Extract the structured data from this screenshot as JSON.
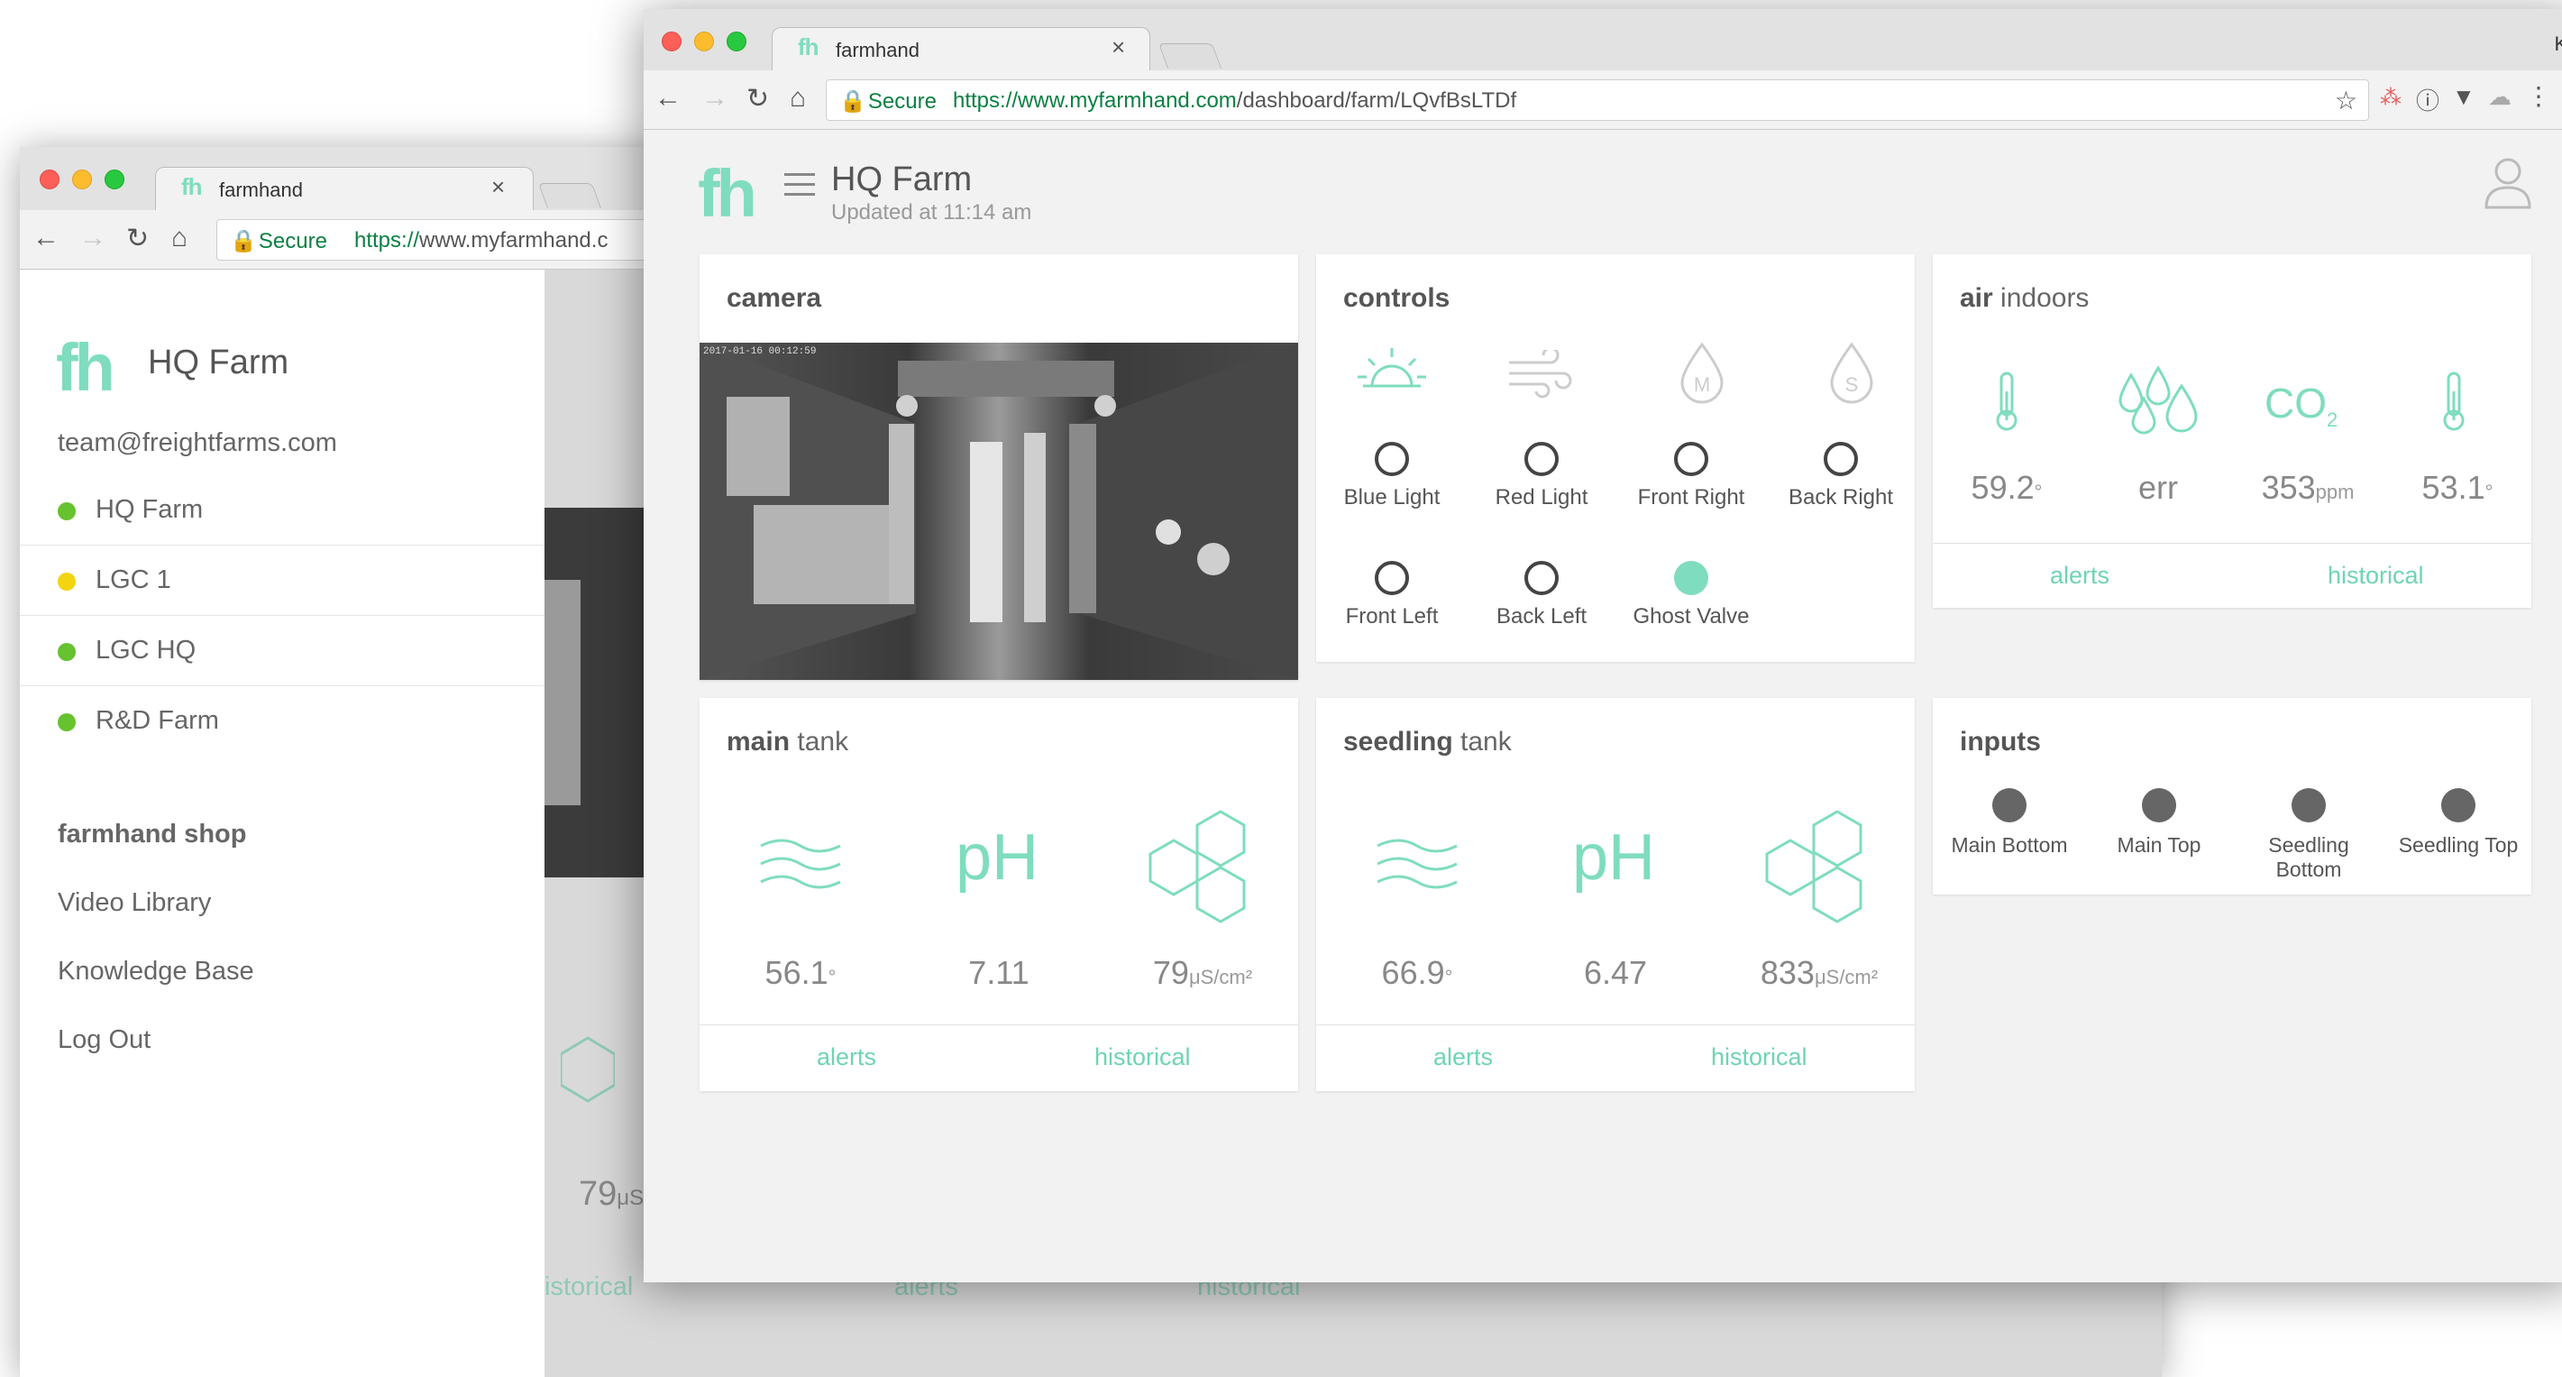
{
  "back_window": {
    "tab_title": "farmhand",
    "tab_favicon": "fh",
    "secure_label": "Secure",
    "url_scheme": "https://",
    "url_host": "www.myfarmhand.c",
    "sidebar": {
      "logo": "fh",
      "farm_name": "HQ Farm",
      "email": "team@freightfarms.com",
      "farms": [
        {
          "label": "HQ Farm",
          "status_color": "#66c22e"
        },
        {
          "label": "LGC 1",
          "status_color": "#f2d410"
        },
        {
          "label": "LGC HQ",
          "status_color": "#66c22e"
        },
        {
          "label": "R&D Farm",
          "status_color": "#66c22e"
        }
      ],
      "shop": "farmhand shop",
      "links": [
        "Video Library",
        "Knowledge Base",
        "Log Out"
      ]
    },
    "behind": {
      "value": "79",
      "unit": "μS",
      "historical": "istorical",
      "alerts": "alerts",
      "historical2": "historical"
    }
  },
  "front_window": {
    "tab_title": "farmhand",
    "tab_favicon": "fh",
    "user_name": "Kyl",
    "secure_label": "Secure",
    "url_scheme": "https://",
    "url_host": "www.myfarmhand.com",
    "url_path": "/dashboard/farm/LQvfBsLTDf"
  },
  "app": {
    "logo": "fh",
    "farm_name": "HQ Farm",
    "updated": "Updated at 11:14 am",
    "accent_color": "#7fdcbf"
  },
  "camera": {
    "title": "camera",
    "timestamp": "2017-01-16 00:12:59"
  },
  "controls": {
    "title": "controls",
    "items": [
      {
        "label": "Blue Light",
        "on": false
      },
      {
        "label": "Red Light",
        "on": false
      },
      {
        "label": "Front Right",
        "on": false
      },
      {
        "label": "Back Right",
        "on": false
      },
      {
        "label": "Front Left",
        "on": false
      },
      {
        "label": "Back Left",
        "on": false
      },
      {
        "label": "Ghost Valve",
        "on": true
      }
    ],
    "icons": [
      "sun-icon",
      "wind-icon",
      "drop-m-icon",
      "drop-s-icon"
    ],
    "icon_letters": [
      "M",
      "S"
    ]
  },
  "air": {
    "title_bold": "air",
    "title_rest": " indoors",
    "temp1": "59.2",
    "humidity": "err",
    "co2_label": "CO",
    "co2_sub": "2",
    "co2_value": "353",
    "co2_unit": "ppm",
    "temp2": "53.1",
    "deg": "°",
    "alerts": "alerts",
    "historical": "historical"
  },
  "main_tank": {
    "title_bold": "main",
    "title_rest": " tank",
    "ph_label": "pH",
    "temp": "56.1",
    "ph": "7.11",
    "ec": "79",
    "ec_unit": "μS/cm²",
    "deg": "°",
    "alerts": "alerts",
    "historical": "historical"
  },
  "seedling_tank": {
    "title_bold": "seedling",
    "title_rest": " tank",
    "ph_label": "pH",
    "temp": "66.9",
    "ph": "6.47",
    "ec": "833",
    "ec_unit": "μS/cm²",
    "deg": "°",
    "alerts": "alerts",
    "historical": "historical"
  },
  "inputs": {
    "title": "inputs",
    "items": [
      {
        "line1": "Main Bottom",
        "line2": ""
      },
      {
        "line1": "Main Top",
        "line2": ""
      },
      {
        "line1": "Seedling",
        "line2": "Bottom"
      },
      {
        "line1": "Seedling Top",
        "line2": ""
      }
    ]
  }
}
